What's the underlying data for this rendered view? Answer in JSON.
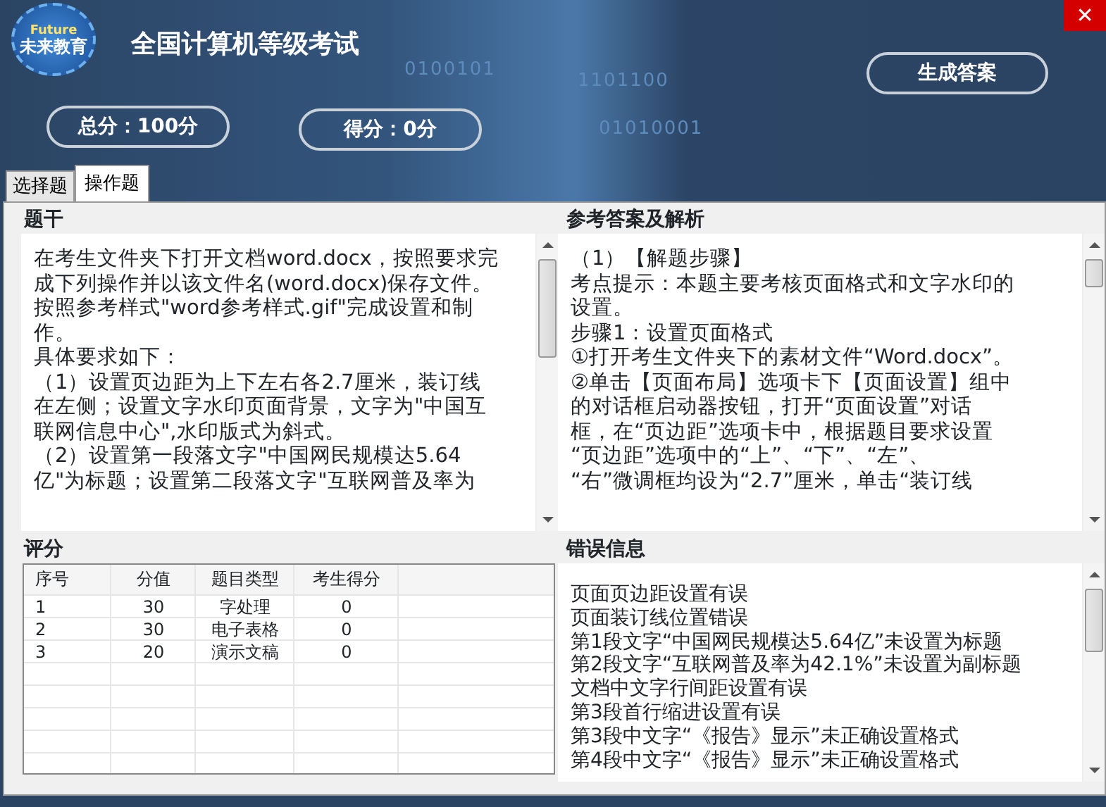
{
  "window": {
    "title": "全国计算机等级考试",
    "close": "✕"
  },
  "logo": {
    "top": "Future",
    "main": "未来教育"
  },
  "banner_digits": [
    "0100101",
    "1101100",
    "01010001"
  ],
  "generate_button": "生成答案",
  "total_score": "总分：100分",
  "earned_score": "得分：0分",
  "tabs": [
    {
      "label": "选择题",
      "selected": false
    },
    {
      "label": "操作题",
      "selected": true
    }
  ],
  "question": {
    "title": "题干",
    "lines": [
      "在考生文件夹下打开文档word.docx，按照要求完",
      "成下列操作并以该文件名(word.docx)保存文件。",
      "按照参考样式\"word参考样式.gif\"完成设置和制",
      "作。",
      "具体要求如下：",
      "（1）设置页边距为上下左右各2.7厘米，装订线",
      "在左侧；设置文字水印页面背景，文字为\"中国互",
      "联网信息中心\",水印版式为斜式。",
      "（2）设置第一段落文字\"中国网民规模达5.64",
      "亿\"为标题；设置第二段落文字\"互联网普及率为"
    ]
  },
  "answer": {
    "title": "参考答案及解析",
    "lines": [
      "（1）【解题步骤】",
      "考点提示：本题主要考核页面格式和文字水印的",
      "设置。",
      "步骤1：设置页面格式",
      "①打开考生文件夹下的素材文件“Word.docx”。",
      "②单击【页面布局】选项卡下【页面设置】组中",
      "的对话框启动器按钮，打开“页面设置”对话",
      "框，在“页边距”选项卡中，根据题目要求设置",
      "“页边距”选项中的“上”、“下”、“左”、",
      "“右”微调框均设为“2.7”厘米，单击“装订线"
    ]
  },
  "scoring": {
    "title": "评分",
    "columns": [
      "序号",
      "分值",
      "题目类型",
      "考生得分"
    ],
    "rows": [
      [
        "1",
        "30",
        "字处理",
        "0"
      ],
      [
        "2",
        "30",
        "电子表格",
        "0"
      ],
      [
        "3",
        "20",
        "演示文稿",
        "0"
      ]
    ]
  },
  "errors": {
    "title": "错误信息",
    "lines": [
      "页面页边距设置有误",
      "页面装订线位置错误",
      "第1段文字“中国网民规模达5.64亿”未设置为标题",
      "第2段文字“互联网普及率为42.1%”未设置为副标题",
      "文档中文字行间距设置有误",
      "第3段首行缩进设置有误",
      "第3段中文字“《报告》显示”未正确设置格式",
      "第4段中文字“《报告》显示”未正确设置格式"
    ]
  }
}
